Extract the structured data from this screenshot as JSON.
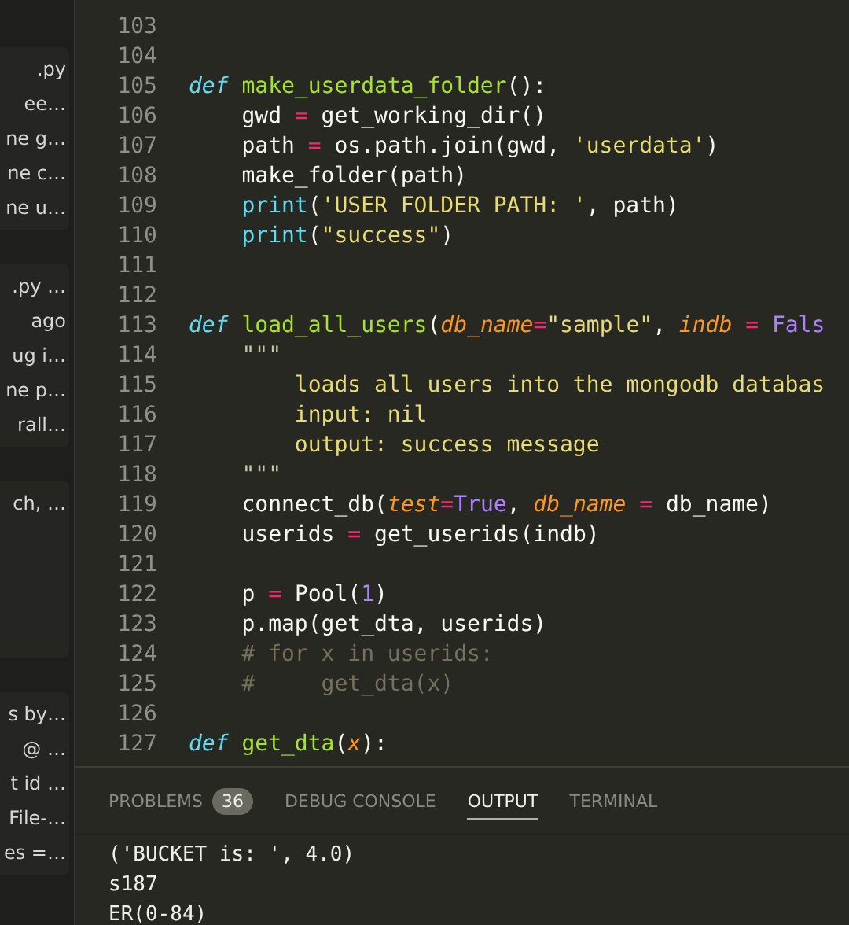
{
  "sidebar": {
    "groups": [
      {
        "items": [
          ".py",
          "ee…",
          "ne g…",
          "ne c…",
          "ne u…"
        ]
      },
      {
        "items": [
          ".py …",
          "ago",
          "ug i…",
          "ne p…",
          "rall…"
        ]
      },
      {
        "items": [
          "ch, …"
        ]
      },
      {
        "items": [
          "s by…",
          "@ …",
          "t id …",
          "File-…",
          "es =…"
        ]
      }
    ]
  },
  "editor": {
    "lines": [
      {
        "number": "103"
      },
      {
        "number": "104"
      },
      {
        "number": "105",
        "tokens": [
          {
            "kind": "keyword",
            "text": "def "
          },
          {
            "kind": "function",
            "text": "make_userdata_folder"
          },
          {
            "kind": "plain",
            "text": "():"
          }
        ]
      },
      {
        "number": "106",
        "tokens": [
          {
            "kind": "plain",
            "text": "    gwd "
          },
          {
            "kind": "operator",
            "text": "="
          },
          {
            "kind": "plain",
            "text": " get_working_dir()"
          }
        ]
      },
      {
        "number": "107",
        "tokens": [
          {
            "kind": "plain",
            "text": "    path "
          },
          {
            "kind": "operator",
            "text": "="
          },
          {
            "kind": "plain",
            "text": " os.path.join(gwd, "
          },
          {
            "kind": "string",
            "text": "'userdata'"
          },
          {
            "kind": "plain",
            "text": ")"
          }
        ]
      },
      {
        "number": "108",
        "tokens": [
          {
            "kind": "plain",
            "text": "    make_folder(path)"
          }
        ]
      },
      {
        "number": "109",
        "tokens": [
          {
            "kind": "builtin",
            "text": "    print"
          },
          {
            "kind": "plain",
            "text": "("
          },
          {
            "kind": "string",
            "text": "'USER FOLDER PATH: '"
          },
          {
            "kind": "plain",
            "text": ", path)"
          }
        ]
      },
      {
        "number": "110",
        "tokens": [
          {
            "kind": "builtin",
            "text": "    print"
          },
          {
            "kind": "plain",
            "text": "("
          },
          {
            "kind": "string",
            "text": "\"success\""
          },
          {
            "kind": "plain",
            "text": ")"
          }
        ]
      },
      {
        "number": "111"
      },
      {
        "number": "112"
      },
      {
        "number": "113",
        "tokens": [
          {
            "kind": "keyword",
            "text": "def "
          },
          {
            "kind": "function",
            "text": "load_all_users"
          },
          {
            "kind": "plain",
            "text": "("
          },
          {
            "kind": "param",
            "text": "db_name"
          },
          {
            "kind": "operator",
            "text": "="
          },
          {
            "kind": "string",
            "text": "\"sample\""
          },
          {
            "kind": "plain",
            "text": ", "
          },
          {
            "kind": "param",
            "text": "indb "
          },
          {
            "kind": "operator",
            "text": "= "
          },
          {
            "kind": "constant",
            "text": "Fals"
          }
        ]
      },
      {
        "number": "114",
        "tokens": [
          {
            "kind": "docstring",
            "text": "    \"\"\""
          }
        ]
      },
      {
        "number": "115",
        "tokens": [
          {
            "kind": "string",
            "text": "        loads all users into the mongodb databas"
          }
        ]
      },
      {
        "number": "116",
        "tokens": [
          {
            "kind": "string",
            "text": "        input: nil"
          }
        ]
      },
      {
        "number": "117",
        "tokens": [
          {
            "kind": "string",
            "text": "        output: success message"
          }
        ]
      },
      {
        "number": "118",
        "tokens": [
          {
            "kind": "docstring",
            "text": "    \"\"\""
          }
        ]
      },
      {
        "number": "119",
        "tokens": [
          {
            "kind": "plain",
            "text": "    connect_db("
          },
          {
            "kind": "param",
            "text": "test"
          },
          {
            "kind": "operator",
            "text": "="
          },
          {
            "kind": "constant",
            "text": "True"
          },
          {
            "kind": "plain",
            "text": ", "
          },
          {
            "kind": "param",
            "text": "db_name "
          },
          {
            "kind": "operator",
            "text": "="
          },
          {
            "kind": "plain",
            "text": " db_name)"
          }
        ]
      },
      {
        "number": "120",
        "tokens": [
          {
            "kind": "plain",
            "text": "    userids "
          },
          {
            "kind": "operator",
            "text": "="
          },
          {
            "kind": "plain",
            "text": " get_userids(indb)"
          }
        ]
      },
      {
        "number": "121"
      },
      {
        "number": "122",
        "tokens": [
          {
            "kind": "plain",
            "text": "    p "
          },
          {
            "kind": "operator",
            "text": "="
          },
          {
            "kind": "plain",
            "text": " Pool("
          },
          {
            "kind": "constant",
            "text": "1"
          },
          {
            "kind": "plain",
            "text": ")"
          }
        ]
      },
      {
        "number": "123",
        "tokens": [
          {
            "kind": "plain",
            "text": "    p.map(get_dta, userids)"
          }
        ]
      },
      {
        "number": "124",
        "tokens": [
          {
            "kind": "comment",
            "text": "    # for x in userids:"
          }
        ]
      },
      {
        "number": "125",
        "tokens": [
          {
            "kind": "comment",
            "text": "    #     get_dta(x)"
          }
        ]
      },
      {
        "number": "126"
      },
      {
        "number": "127",
        "tokens": [
          {
            "kind": "keyword",
            "text": "def "
          },
          {
            "kind": "function",
            "text": "get_dta"
          },
          {
            "kind": "plain",
            "text": "("
          },
          {
            "kind": "param",
            "text": "x"
          },
          {
            "kind": "plain",
            "text": "):"
          }
        ]
      }
    ]
  },
  "panel": {
    "tabs": [
      {
        "label": "PROBLEMS",
        "badge": "36",
        "selected": false
      },
      {
        "label": "DEBUG CONSOLE",
        "selected": false
      },
      {
        "label": "OUTPUT",
        "selected": true
      },
      {
        "label": "TERMINAL",
        "selected": false
      }
    ],
    "output": [
      "('BUCKET is: ', 4.0)",
      "s187",
      "ER(0-84)"
    ]
  }
}
